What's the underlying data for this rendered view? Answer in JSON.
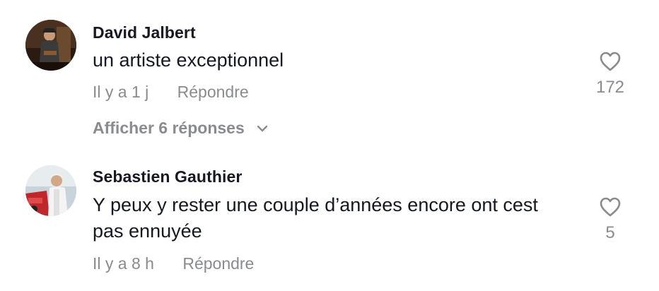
{
  "comments": [
    {
      "username": "David Jalbert",
      "text": "un artiste exceptionnel",
      "time": "Il y a 1 j",
      "reply_label": "Répondre",
      "like_count": "172",
      "view_replies_label": "Afficher 6 réponses",
      "avatar_icon": "avatar-photo"
    },
    {
      "username": "Sebastien Gauthier",
      "text": "Y peux y rester une couple d’années encore ont cest pas ennuyée",
      "time": "Il y a 8 h",
      "reply_label": "Répondre",
      "like_count": "5",
      "avatar_icon": "avatar-photo"
    }
  ],
  "icons": {
    "like": "heart-icon",
    "expand": "chevron-down-icon"
  },
  "colors": {
    "primary_text": "#161823",
    "secondary_text": "#8a8b91",
    "background": "#ffffff"
  }
}
